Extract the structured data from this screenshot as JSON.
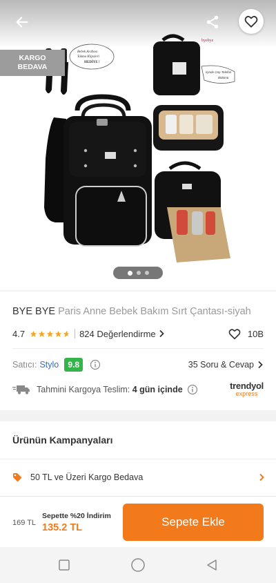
{
  "header": {
    "badge_line1": "KARGO",
    "badge_line2": "BEDAVA",
    "back_icon": "arrow-left-icon",
    "share_icon": "share-icon",
    "favorite_icon": "heart-outline-icon"
  },
  "gallery": {
    "image_count": 3,
    "active_index": 0,
    "overlay_texts": {
      "callout_left": "Bebek Arabası Takma Klipsleri HEDİYE !",
      "callout_right": "İçinde Cep Telefon Bölümü",
      "brand_mark": "byebye"
    }
  },
  "product": {
    "brand": "BYE BYE",
    "name": "Paris Anne Bebek Bakım Sırt Çantası-siyah",
    "rating": "4.7",
    "stars": 4.7,
    "reviews_label": "824 Değerlendirme",
    "likes": "10B"
  },
  "seller": {
    "label": "Satıcı:",
    "name": "Stylo",
    "score": "9.8",
    "qa_label": "35 Soru & Cevap"
  },
  "delivery": {
    "label": "Tahmini Kargoya Teslim:",
    "value": "4 gün içinde",
    "carrier_line1": "trendyol",
    "carrier_line2": "express"
  },
  "campaigns": {
    "title": "Ürünün Kampanyaları",
    "items": [
      {
        "label": "50 TL ve Üzeri Kargo Bedava"
      }
    ]
  },
  "buy": {
    "old_price": "169 TL",
    "discount_label": "Sepette %20 İndirim",
    "new_price": "135.2 TL",
    "button_label": "Sepete Ekle"
  },
  "colors": {
    "accent": "#f27a1a",
    "seller_link": "#2f6fc9",
    "score_badge": "#35b44a",
    "star": "#f5a623"
  }
}
